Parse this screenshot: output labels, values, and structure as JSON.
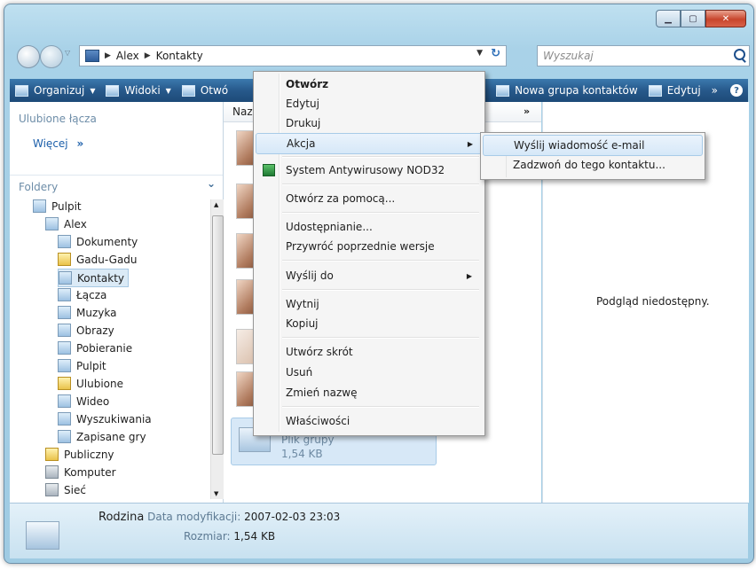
{
  "address": {
    "crumbs": [
      "Alex",
      "Kontakty"
    ],
    "search_placeholder": "Wyszukaj"
  },
  "toolbar": {
    "organize": "Organizuj",
    "views": "Widoki",
    "open": "Otwó",
    "new_group": "Nowa grupa kontaktów",
    "edit": "Edytuj",
    "more": "»",
    "help": "?"
  },
  "nav": {
    "favorites_header": "Ulubione łącza",
    "more_label": "Więcej",
    "more_glyph": "»",
    "folders_header": "Foldery",
    "tree": [
      {
        "label": "Pulpit",
        "level": 0
      },
      {
        "label": "Alex",
        "level": 1
      },
      {
        "label": "Dokumenty",
        "level": 2
      },
      {
        "label": "Gadu-Gadu",
        "level": 2
      },
      {
        "label": "Kontakty",
        "level": 2,
        "selected": true
      },
      {
        "label": "Łącza",
        "level": 2
      },
      {
        "label": "Muzyka",
        "level": 2
      },
      {
        "label": "Obrazy",
        "level": 2
      },
      {
        "label": "Pobieranie",
        "level": 2
      },
      {
        "label": "Pulpit",
        "level": 2
      },
      {
        "label": "Ulubione",
        "level": 2
      },
      {
        "label": "Wideo",
        "level": 2
      },
      {
        "label": "Wyszukiwania",
        "level": 2
      },
      {
        "label": "Zapisane gry",
        "level": 2
      },
      {
        "label": "Publiczny",
        "level": 1
      },
      {
        "label": "Komputer",
        "level": 1
      },
      {
        "label": "Sieć",
        "level": 1
      }
    ]
  },
  "content": {
    "column_header": "Nazw",
    "more": "»",
    "selected_item": {
      "type": "Plik grupy",
      "size": "1,54 KB"
    }
  },
  "preview": {
    "text": "Podgląd niedostępny."
  },
  "details": {
    "name": "Rodzina",
    "modified_label": "Data modyfikacji:",
    "modified_value": "2007-02-03 23:03",
    "size_label": "Rozmiar:",
    "size_value": "1,54 KB"
  },
  "context_menu": {
    "items": [
      "Otwórz",
      "Edytuj",
      "Drukuj",
      "Akcja",
      "System Antywirusowy NOD32",
      "Otwórz za pomocą...",
      "Udostępnianie...",
      "Przywróć poprzednie wersje",
      "Wyślij do",
      "Wytnij",
      "Kopiuj",
      "Utwórz skrót",
      "Usuń",
      "Zmień nazwę",
      "Właściwości"
    ]
  },
  "submenu": {
    "items": [
      "Wyślij wiadomość e-mail",
      "Zadzwoń do tego kontaktu..."
    ]
  },
  "colors": {
    "toolbar": "#27598b",
    "highlight": "#d6e8f8",
    "accent": "#1c5faa"
  }
}
